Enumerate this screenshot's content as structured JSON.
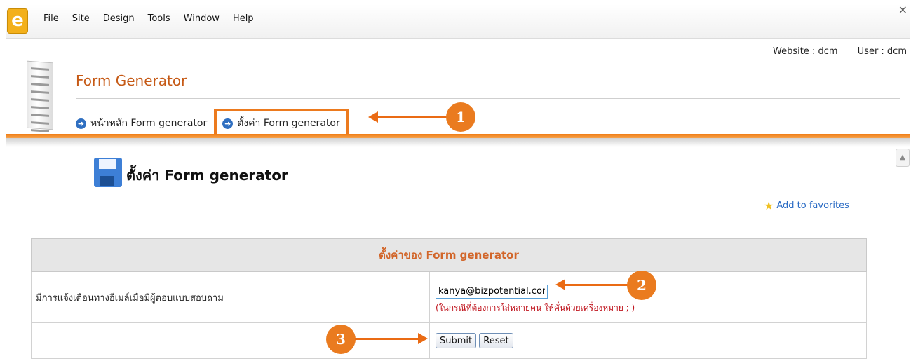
{
  "menubar": {
    "logo": "e",
    "items": [
      "File",
      "Site",
      "Design",
      "Tools",
      "Window",
      "Help"
    ],
    "close": "×"
  },
  "header": {
    "website": "Website : dcm",
    "user": "User : dcm",
    "title": "Form Generator",
    "crumbs": [
      "หน้าหลัก Form generator",
      "ตั้งค่า Form generator"
    ]
  },
  "content": {
    "heading": "ตั้งค่า Form generator",
    "add_favorites": "Add to favorites",
    "table_title": "ตั้งค่าของ Form generator",
    "email_label": "มีการแจ้งเตือนทางอีเมล์เมื่อมีผู้ตอบแบบสอบถาม",
    "email_value": "kanya@bizpotential.com",
    "email_hint": "(ในกรณีที่ต้องการใส่หลายคน ให้คั่นด้วยเครื่องหมาย ; )",
    "submit_label": "Submit",
    "reset_label": "Reset"
  },
  "callouts": [
    "1",
    "2",
    "3"
  ],
  "colors": {
    "accent": "#ea7b1f",
    "title": "#c65a16",
    "link": "#2a6bc4",
    "hint": "#c0161f"
  }
}
